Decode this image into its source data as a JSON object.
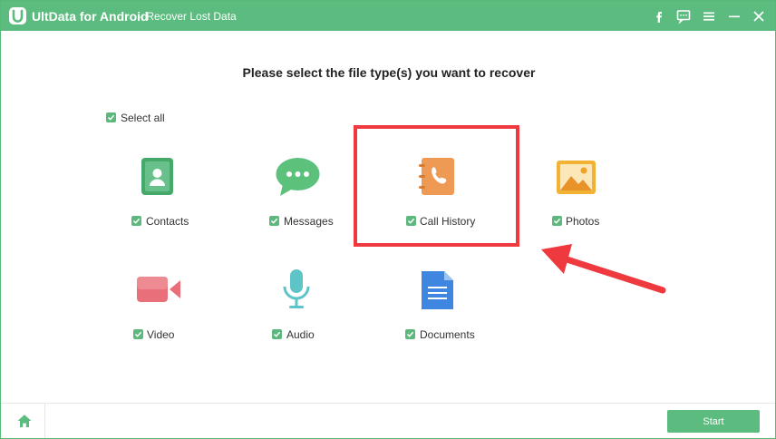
{
  "window": {
    "app_name": "UltData for Android",
    "subtitle": "- Recover Lost Data"
  },
  "titlebar_icons": [
    "facebook-icon",
    "feedback-icon",
    "menu-icon",
    "minimize-icon",
    "close-icon"
  ],
  "main": {
    "heading": "Please select the file type(s) you want to recover",
    "select_all": {
      "label": "Select all",
      "checked": true
    },
    "file_types": [
      {
        "label": "Contacts",
        "icon": "contacts-icon",
        "checked": true,
        "color": "#46a869"
      },
      {
        "label": "Messages",
        "icon": "messages-icon",
        "checked": true,
        "color": "#5cc17a"
      },
      {
        "label": "Call History",
        "icon": "call-history-icon",
        "checked": true,
        "color": "#ee9a55"
      },
      {
        "label": "Photos",
        "icon": "photos-icon",
        "checked": true,
        "color": "#f2b234"
      },
      {
        "label": "Video",
        "icon": "video-icon",
        "checked": true,
        "color": "#e9707a"
      },
      {
        "label": "Audio",
        "icon": "audio-icon",
        "checked": true,
        "color": "#5ec4c8"
      },
      {
        "label": "Documents",
        "icon": "documents-icon",
        "checked": true,
        "color": "#3f86e0"
      }
    ]
  },
  "footer": {
    "start_label": "Start"
  },
  "colors": {
    "brand": "#5cbb7f",
    "checkbox": "#5cb87c",
    "highlight": "#ee3a3f"
  }
}
